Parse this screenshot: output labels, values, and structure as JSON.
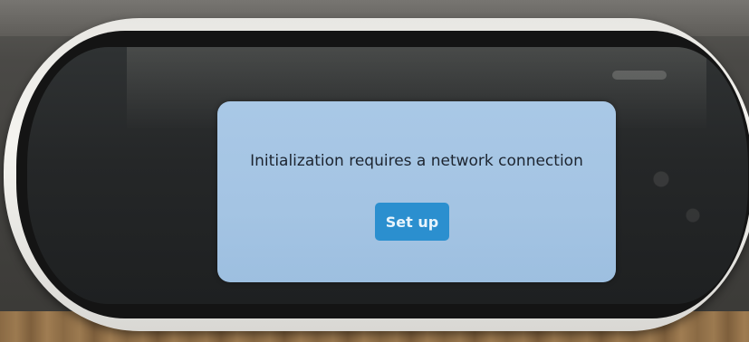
{
  "dialog": {
    "message": "Initialization requires a network connection",
    "setup_button_label": "Set up"
  },
  "colors": {
    "dialog_background": "#a7c6e5",
    "button_background": "#2b8fcf",
    "button_text": "#e8f4fc",
    "message_text": "#1d2530"
  }
}
